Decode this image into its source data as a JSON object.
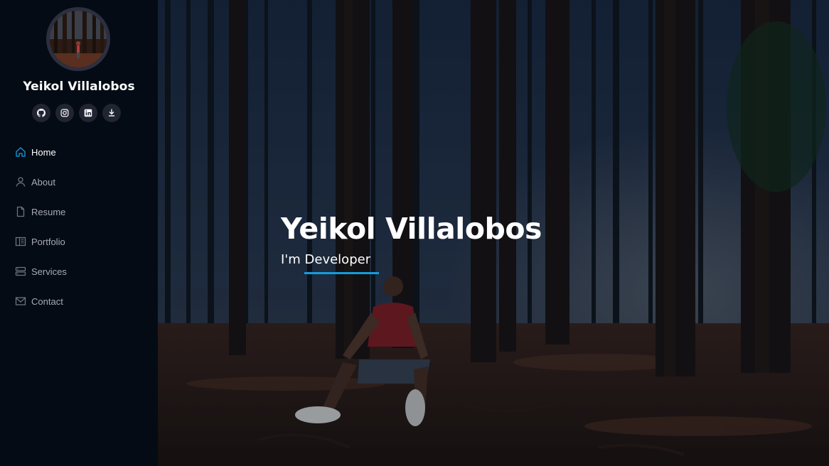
{
  "profile": {
    "name": "Yeikol Villalobos"
  },
  "social": [
    {
      "icon": "github-icon"
    },
    {
      "icon": "instagram-icon"
    },
    {
      "icon": "linkedin-icon"
    },
    {
      "icon": "download-icon"
    }
  ],
  "nav": {
    "items": [
      {
        "label": "Home",
        "icon": "home-icon",
        "active": true
      },
      {
        "label": "About",
        "icon": "user-icon",
        "active": false
      },
      {
        "label": "Resume",
        "icon": "file-icon",
        "active": false
      },
      {
        "label": "Portfolio",
        "icon": "book-icon",
        "active": false
      },
      {
        "label": "Services",
        "icon": "server-icon",
        "active": false
      },
      {
        "label": "Contact",
        "icon": "envelope-icon",
        "active": false
      }
    ]
  },
  "hero": {
    "title": "Yeikol Villalobos",
    "subtitle": "I'm Developer"
  },
  "colors": {
    "accent": "#149ddd",
    "sidebar_bg": "#040b14",
    "nav_text": "#a8a9b4"
  }
}
